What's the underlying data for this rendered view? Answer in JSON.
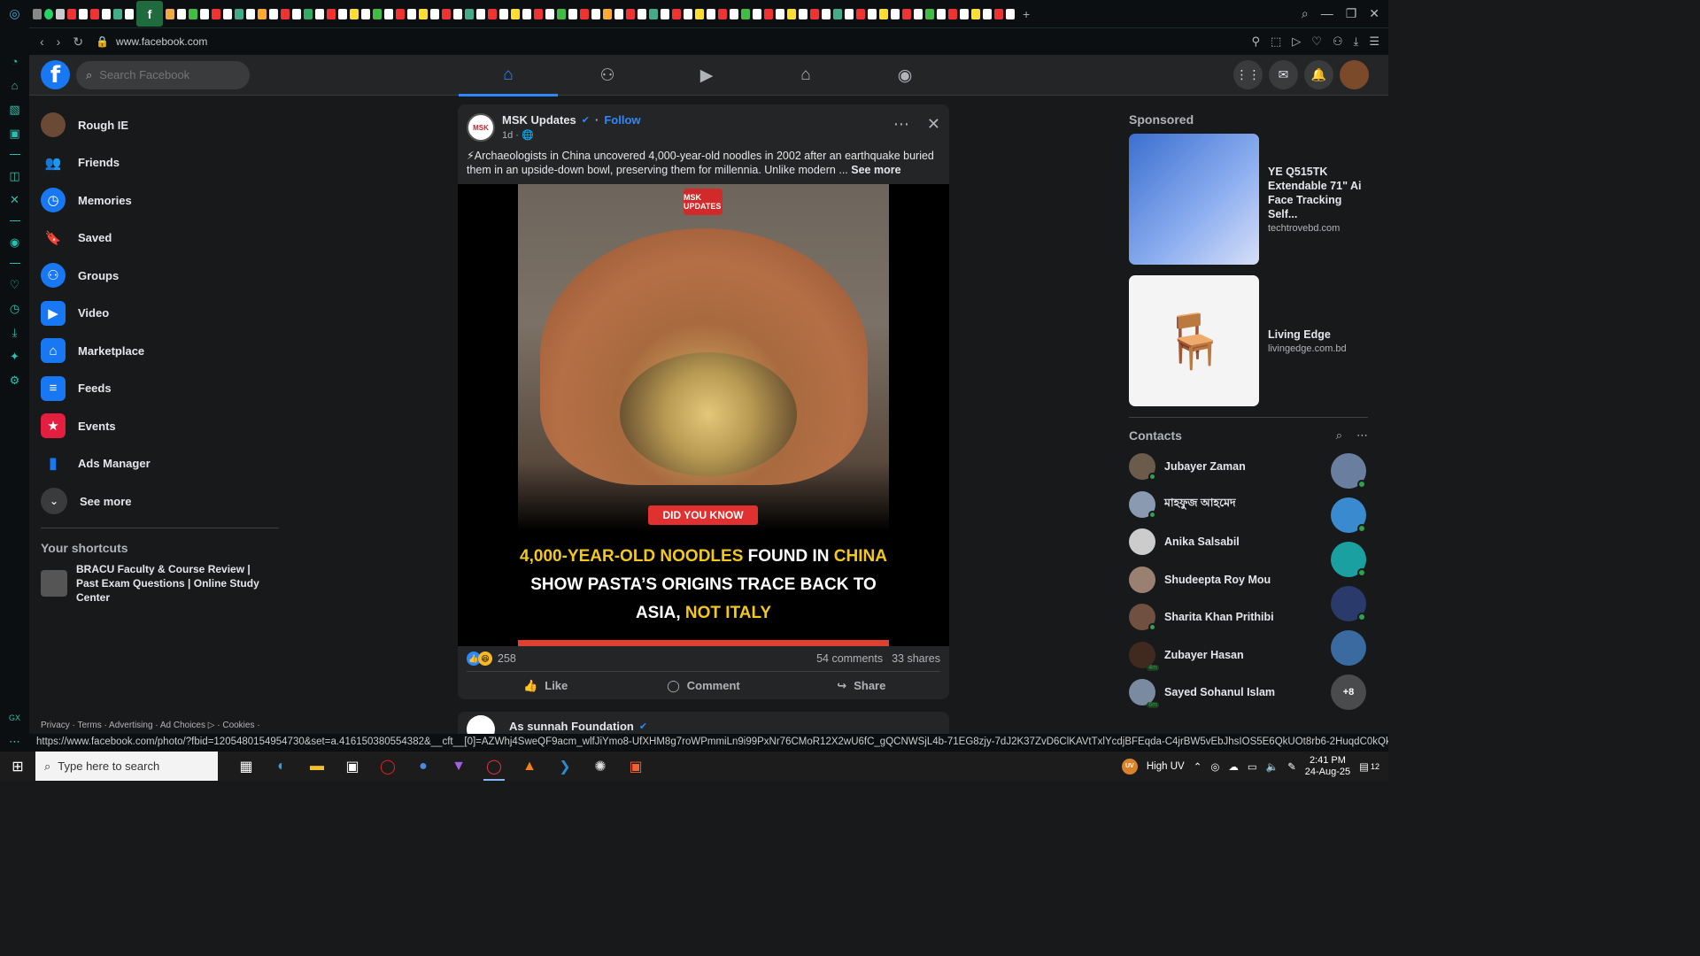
{
  "browser": {
    "url": "www.facebook.com",
    "status_url": "https://www.facebook.com/photo/?fbid=1205480154954730&set=a.416150380554382&__cft__[0]=AZWhj4SweQF9acm_wlfJiYmo8-UfXHM8g7roWPmmiLn9i99PxNr76CMoR12X2wU6fC_gQCNWSjL4b-71EG8zjy-7dJ2K37ZvD6ClKAVtTxlYcdjBFEqda-C4jrBW5vEbJhsIOS5E6QkUOt8rb6-2HuqdC0kQkila54ss..."
  },
  "fb": {
    "search_placeholder": "Search Facebook"
  },
  "left_menu": {
    "items": [
      {
        "label": "Rough IE",
        "icon": "profile-avatar"
      },
      {
        "label": "Friends",
        "icon": "friends-icon",
        "color": "#1877f2"
      },
      {
        "label": "Memories",
        "icon": "clock-icon",
        "color": "#1877f2"
      },
      {
        "label": "Saved",
        "icon": "bookmark-icon",
        "color": "#9b51e0"
      },
      {
        "label": "Groups",
        "icon": "groups-icon",
        "color": "#1877f2"
      },
      {
        "label": "Video",
        "icon": "video-icon",
        "color": "#1877f2"
      },
      {
        "label": "Marketplace",
        "icon": "marketplace-icon",
        "color": "#1877f2"
      },
      {
        "label": "Feeds",
        "icon": "feeds-icon",
        "color": "#1877f2"
      },
      {
        "label": "Events",
        "icon": "events-icon",
        "color": "#e41e3f"
      },
      {
        "label": "Ads Manager",
        "icon": "ads-manager-icon",
        "color": "#1877f2"
      },
      {
        "label": "See more",
        "icon": "chevron-down-icon"
      }
    ],
    "shortcuts_title": "Your shortcuts",
    "shortcut_label": "BRACU Faculty & Course Review | Past Exam Questions | Online Study Center",
    "footer": "Privacy · Terms · Advertising · Ad Choices ▷ · Cookies ·"
  },
  "post": {
    "page_name": "MSK Updates",
    "follow": "Follow",
    "time": "1d · 🌐",
    "text": "⚡Archaeologists in China uncovered 4,000-year-old noodles in 2002 after an earthquake buried them in an upside-down bowl, preserving them for millennia. Unlike modern ...",
    "see_more": "See more",
    "image": {
      "logo": "MSK UPDATES",
      "badge": "DID YOU KNOW",
      "line1_a": "4,000-YEAR-OLD NOODLES",
      "line1_b": " FOUND IN ",
      "line1_c": "CHINA",
      "line2": "SHOW PASTA’S ORIGINS TRACE BACK TO",
      "line3_a": "ASIA, ",
      "line3_b": "NOT ITALY"
    },
    "reactions_count": "258",
    "comments": "54 comments",
    "shares": "33 shares",
    "like": "Like",
    "comment": "Comment",
    "share": "Share"
  },
  "post2": {
    "page_name": "As sunnah Foundation"
  },
  "right": {
    "sponsored": "Sponsored",
    "ads": [
      {
        "title": "YE Q515TK Extendable 71\" Ai Face Tracking Self...",
        "site": "techtrovebd.com"
      },
      {
        "title": "Living Edge",
        "site": "livingedge.com.bd"
      }
    ],
    "contacts_title": "Contacts",
    "contacts": [
      {
        "name": "Jubayer Zaman",
        "status": "online"
      },
      {
        "name": "মাহফুজ আহমেদ",
        "status": "online"
      },
      {
        "name": "Anika Salsabil",
        "status": "none"
      },
      {
        "name": "Shudeepta Roy Mou",
        "status": "none"
      },
      {
        "name": "Sharita Khan Prithibi",
        "status": "online"
      },
      {
        "name": "Zubayer Hasan",
        "status": "4m"
      },
      {
        "name": "Sayed Sohanul Islam",
        "status": "6m"
      }
    ],
    "chat_more": "+8"
  },
  "taskbar": {
    "search_placeholder": "Type here to search",
    "weather": "High UV",
    "time": "2:41 PM",
    "date": "24-Aug-25",
    "notif_count": "12"
  }
}
